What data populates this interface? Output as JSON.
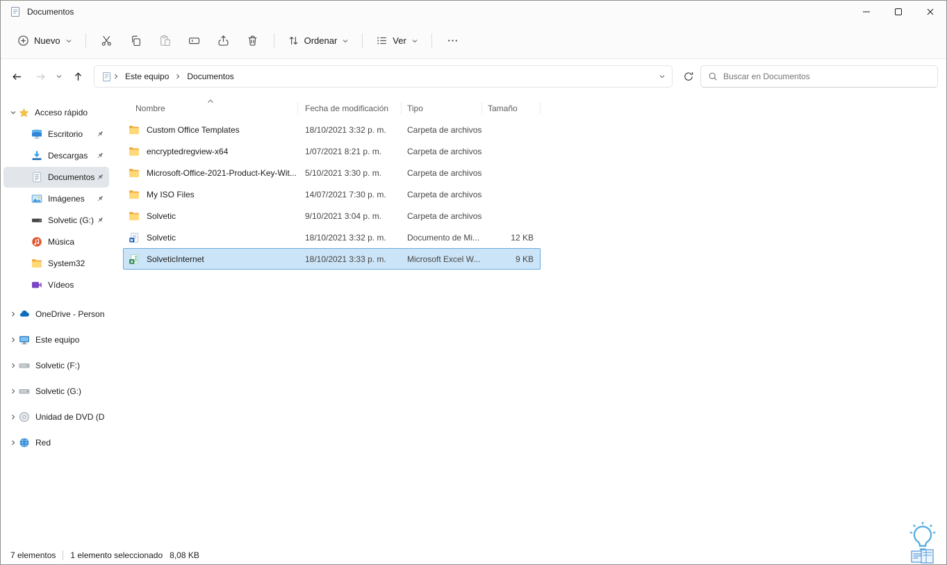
{
  "window": {
    "title": "Documentos"
  },
  "toolbar": {
    "new_label": "Nuevo",
    "sort_label": "Ordenar",
    "view_label": "Ver"
  },
  "navbar": {
    "breadcrumb": {
      "root": "Este equipo",
      "current": "Documentos"
    },
    "search_placeholder": "Buscar en Documentos"
  },
  "sidebar": {
    "quick_access": {
      "label": "Acceso rápido",
      "items": [
        {
          "label": "Escritorio",
          "icon": "desktop-icon",
          "pinned": true
        },
        {
          "label": "Descargas",
          "icon": "downloads-icon",
          "pinned": true
        },
        {
          "label": "Documentos",
          "icon": "documents-icon",
          "pinned": true,
          "selected": true
        },
        {
          "label": "Imágenes",
          "icon": "pictures-icon",
          "pinned": true
        },
        {
          "label": "Solvetic (G:)",
          "icon": "hard-drive-dark-icon",
          "pinned": true
        },
        {
          "label": "Música",
          "icon": "music-icon",
          "pinned": false
        },
        {
          "label": "System32",
          "icon": "folder-icon",
          "pinned": false
        },
        {
          "label": "Vídeos",
          "icon": "videos-icon",
          "pinned": false
        }
      ]
    },
    "tree_items": [
      {
        "label": "OneDrive - Personal",
        "icon": "onedrive-icon"
      },
      {
        "label": "Este equipo",
        "icon": "computer-icon"
      },
      {
        "label": "Solvetic (F:)",
        "icon": "hard-drive-icon"
      },
      {
        "label": "Solvetic (G:)",
        "icon": "hard-drive-icon"
      },
      {
        "label": "Unidad de DVD (D:)",
        "icon": "dvd-icon"
      },
      {
        "label": "Red",
        "icon": "network-icon"
      }
    ]
  },
  "file_list": {
    "columns": {
      "name": "Nombre",
      "date": "Fecha de modificación",
      "type": "Tipo",
      "size": "Tamaño"
    },
    "sorted_by": "Nombre",
    "sort_direction": "ascending",
    "rows": [
      {
        "name": "Custom Office Templates",
        "date": "18/10/2021 3:32 p. m.",
        "type": "Carpeta de archivos",
        "size": "",
        "icon": "folder-icon"
      },
      {
        "name": "encryptedregview-x64",
        "date": "1/07/2021 8:21 p. m.",
        "type": "Carpeta de archivos",
        "size": "",
        "icon": "folder-icon"
      },
      {
        "name": "Microsoft-Office-2021-Product-Key-Wit...",
        "date": "5/10/2021 3:30 p. m.",
        "type": "Carpeta de archivos",
        "size": "",
        "icon": "folder-icon"
      },
      {
        "name": "My ISO Files",
        "date": "14/07/2021 7:30 p. m.",
        "type": "Carpeta de archivos",
        "size": "",
        "icon": "folder-icon"
      },
      {
        "name": "Solvetic",
        "date": "9/10/2021 3:04 p. m.",
        "type": "Carpeta de archivos",
        "size": "",
        "icon": "folder-icon"
      },
      {
        "name": "Solvetic",
        "date": "18/10/2021 3:32 p. m.",
        "type": "Documento de Mi...",
        "size": "12 KB",
        "icon": "word-document-icon"
      },
      {
        "name": "SolveticInternet",
        "date": "18/10/2021 3:33 p. m.",
        "type": "Microsoft Excel W...",
        "size": "9 KB",
        "icon": "excel-document-icon",
        "selected": true
      }
    ]
  },
  "statusbar": {
    "item_count": "7 elementos",
    "selection": "1 elemento seleccionado",
    "selection_size": "8,08 KB"
  },
  "icons": {
    "new": "plus-circle",
    "cut": "scissors",
    "copy": "two-pages",
    "paste": "clipboard",
    "rename": "text-field-cursor",
    "share": "arrow-up-tray",
    "delete": "trash-can",
    "sort": "up-down-arrows",
    "view": "list-lines",
    "more": "ellipsis",
    "back": "arrow-left",
    "forward": "arrow-right",
    "recent": "chevron-down",
    "up": "arrow-up",
    "refresh": "circular-arrow",
    "search": "magnifier",
    "pin": "pushpin",
    "quick_access": "star"
  },
  "colors": {
    "accent": "#0067c0",
    "selection_fill": "#cce4f7",
    "selection_border": "#67abde",
    "sidebar_selection": "#e2e6ea",
    "folder": "#ffd978",
    "chrome_background": "#fbfbfb"
  }
}
